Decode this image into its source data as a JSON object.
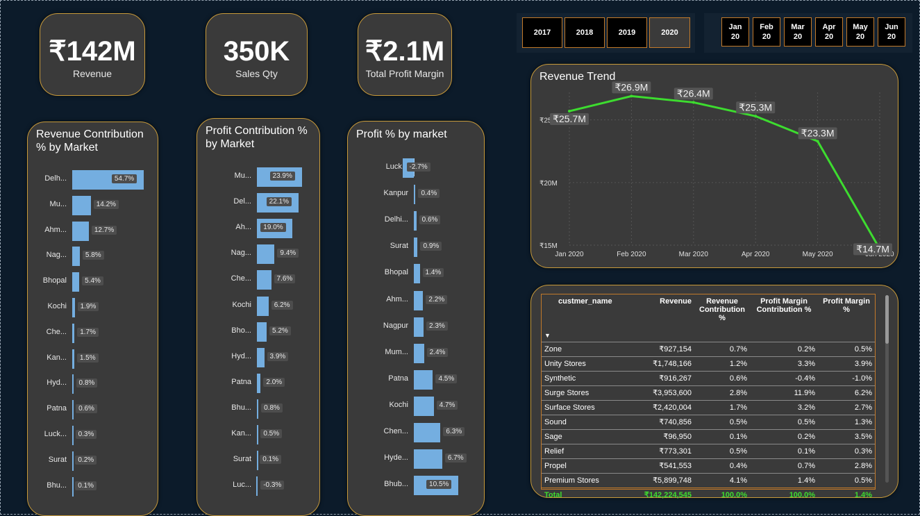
{
  "kpis": [
    {
      "value": "₹142M",
      "label": "Revenue"
    },
    {
      "value": "350K",
      "label": "Sales Qty"
    },
    {
      "value": "₹2.1M",
      "label": "Total Profit Margin"
    }
  ],
  "years": [
    "2017",
    "2018",
    "2019",
    "2020"
  ],
  "selected_year": "2020",
  "months": [
    {
      "m": "Jan",
      "y": "20"
    },
    {
      "m": "Feb",
      "y": "20"
    },
    {
      "m": "Mar",
      "y": "20"
    },
    {
      "m": "Apr",
      "y": "20"
    },
    {
      "m": "May",
      "y": "20"
    },
    {
      "m": "Jun",
      "y": "20"
    }
  ],
  "colors": {
    "bar": "#74aee0",
    "line": "#3ddc2f",
    "border": "#c89a3a",
    "total": "#3ddc2f"
  },
  "revenue_contribution": {
    "title": "Revenue Contribution % by Market",
    "rows": [
      {
        "cat": "Delh...",
        "value": 54.7,
        "label": "54.7%"
      },
      {
        "cat": "Mu...",
        "value": 14.2,
        "label": "14.2%"
      },
      {
        "cat": "Ahm...",
        "value": 12.7,
        "label": "12.7%"
      },
      {
        "cat": "Nag...",
        "value": 5.8,
        "label": "5.8%"
      },
      {
        "cat": "Bhopal",
        "value": 5.4,
        "label": "5.4%"
      },
      {
        "cat": "Kochi",
        "value": 1.9,
        "label": "1.9%"
      },
      {
        "cat": "Che...",
        "value": 1.7,
        "label": "1.7%"
      },
      {
        "cat": "Kan...",
        "value": 1.5,
        "label": "1.5%"
      },
      {
        "cat": "Hyd...",
        "value": 0.8,
        "label": "0.8%"
      },
      {
        "cat": "Patna",
        "value": 0.6,
        "label": "0.6%"
      },
      {
        "cat": "Luck...",
        "value": 0.3,
        "label": "0.3%"
      },
      {
        "cat": "Surat",
        "value": 0.2,
        "label": "0.2%"
      },
      {
        "cat": "Bhu...",
        "value": 0.1,
        "label": "0.1%"
      }
    ]
  },
  "profit_contribution": {
    "title": "Profit Contribution % by Market",
    "rows": [
      {
        "cat": "Mu...",
        "value": 23.9,
        "label": "23.9%"
      },
      {
        "cat": "Del...",
        "value": 22.1,
        "label": "22.1%"
      },
      {
        "cat": "Ah...",
        "value": 19.0,
        "label": "19.0%"
      },
      {
        "cat": "Nag...",
        "value": 9.4,
        "label": "9.4%"
      },
      {
        "cat": "Che...",
        "value": 7.6,
        "label": "7.6%"
      },
      {
        "cat": "Kochi",
        "value": 6.2,
        "label": "6.2%"
      },
      {
        "cat": "Bho...",
        "value": 5.2,
        "label": "5.2%"
      },
      {
        "cat": "Hyd...",
        "value": 3.9,
        "label": "3.9%"
      },
      {
        "cat": "Patna",
        "value": 2.0,
        "label": "2.0%"
      },
      {
        "cat": "Bhu...",
        "value": 0.8,
        "label": "0.8%"
      },
      {
        "cat": "Kan...",
        "value": 0.5,
        "label": "0.5%"
      },
      {
        "cat": "Surat",
        "value": 0.1,
        "label": "0.1%"
      },
      {
        "cat": "Luc...",
        "value": -0.3,
        "label": "-0.3%"
      }
    ]
  },
  "profit_by_market": {
    "title": "Profit % by market",
    "rows": [
      {
        "cat": "Luck...",
        "value": -2.7,
        "label": "-2.7%"
      },
      {
        "cat": "Kanpur",
        "value": 0.4,
        "label": "0.4%"
      },
      {
        "cat": "Delhi...",
        "value": 0.6,
        "label": "0.6%"
      },
      {
        "cat": "Surat",
        "value": 0.9,
        "label": "0.9%"
      },
      {
        "cat": "Bhopal",
        "value": 1.4,
        "label": "1.4%"
      },
      {
        "cat": "Ahm...",
        "value": 2.2,
        "label": "2.2%"
      },
      {
        "cat": "Nagpur",
        "value": 2.3,
        "label": "2.3%"
      },
      {
        "cat": "Mum...",
        "value": 2.4,
        "label": "2.4%"
      },
      {
        "cat": "Patna",
        "value": 4.5,
        "label": "4.5%"
      },
      {
        "cat": "Kochi",
        "value": 4.7,
        "label": "4.7%"
      },
      {
        "cat": "Chen...",
        "value": 6.3,
        "label": "6.3%"
      },
      {
        "cat": "Hyde...",
        "value": 6.7,
        "label": "6.7%"
      },
      {
        "cat": "Bhub...",
        "value": 10.5,
        "label": "10.5%"
      }
    ]
  },
  "chart_data": {
    "type": "line",
    "title": "Revenue Trend",
    "x": [
      "Jan 2020",
      "Feb 2020",
      "Mar 2020",
      "Apr 2020",
      "May 2020",
      "Jun 2020"
    ],
    "values": [
      25.7,
      26.9,
      26.4,
      25.3,
      23.3,
      14.7
    ],
    "data_labels": [
      "₹25.7M",
      "₹26.9M",
      "₹26.4M",
      "₹25.3M",
      "₹23.3M",
      "₹14.7M"
    ],
    "y_ticks": [
      {
        "v": 25,
        "label": "₹25M"
      },
      {
        "v": 20,
        "label": "₹20M"
      },
      {
        "v": 15,
        "label": "₹15M"
      }
    ],
    "ylim": [
      15,
      27.2
    ],
    "grid": true
  },
  "table": {
    "columns": [
      "custmer_name",
      "Revenue",
      "Revenue Contribution %",
      "Profit Margin Contribution %",
      "Profit Margin %"
    ],
    "rows": [
      [
        "Zone",
        "₹927,154",
        "0.7%",
        "0.2%",
        "0.5%"
      ],
      [
        "Unity Stores",
        "₹1,748,166",
        "1.2%",
        "3.3%",
        "3.9%"
      ],
      [
        "Synthetic",
        "₹916,267",
        "0.6%",
        "-0.4%",
        "-1.0%"
      ],
      [
        "Surge Stores",
        "₹3,953,600",
        "2.8%",
        "11.9%",
        "6.2%"
      ],
      [
        "Surface Stores",
        "₹2,420,004",
        "1.7%",
        "3.2%",
        "2.7%"
      ],
      [
        "Sound",
        "₹740,856",
        "0.5%",
        "0.5%",
        "1.3%"
      ],
      [
        "Sage",
        "₹96,950",
        "0.1%",
        "0.2%",
        "3.5%"
      ],
      [
        "Relief",
        "₹773,301",
        "0.5%",
        "0.1%",
        "0.3%"
      ],
      [
        "Propel",
        "₹541,553",
        "0.4%",
        "0.7%",
        "2.8%"
      ],
      [
        "Premium Stores",
        "₹5,899,748",
        "4.1%",
        "1.4%",
        "0.5%"
      ]
    ],
    "total": [
      "Total",
      "₹142,224,545",
      "100.0%",
      "100.0%",
      "1.4%"
    ]
  }
}
